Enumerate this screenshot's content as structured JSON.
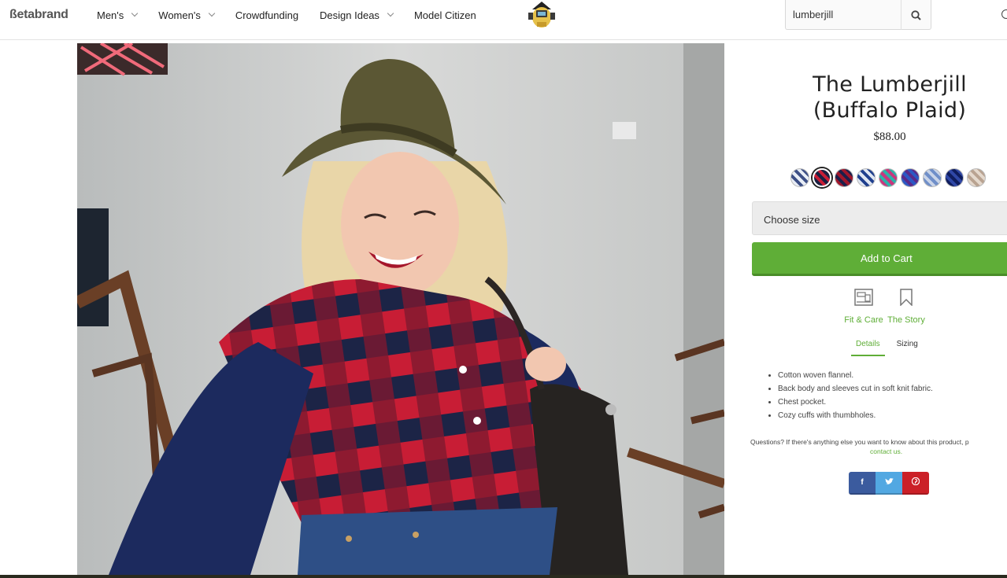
{
  "header": {
    "logo": "ßetabrand",
    "nav": [
      {
        "label": "Men's",
        "dropdown": true
      },
      {
        "label": "Women's",
        "dropdown": true
      },
      {
        "label": "Crowdfunding",
        "dropdown": false
      },
      {
        "label": "Design Ideas",
        "dropdown": true
      },
      {
        "label": "Model Citizen",
        "dropdown": false
      }
    ],
    "search": {
      "value": "lumberjill",
      "icon": "search-icon"
    }
  },
  "product": {
    "title": "The Lumberjill (Buffalo Plaid)",
    "price": "$88.00",
    "swatches": [
      {
        "color": "#3d4f86",
        "alt": "#e9eef6"
      },
      {
        "color": "#c81d35",
        "alt": "#1b2041"
      },
      {
        "color": "#1c1f4a",
        "alt": "#a0162b"
      },
      {
        "color": "#1f3f8e",
        "alt": "#dfe6f2"
      },
      {
        "color": "#2bb3a9",
        "alt": "#c8377d"
      },
      {
        "color": "#5a2a8a",
        "alt": "#2c58c4"
      },
      {
        "color": "#c9d4e8",
        "alt": "#6f8fc9"
      },
      {
        "color": "#2f47a6",
        "alt": "#0f1d5e"
      },
      {
        "color": "#b9a391",
        "alt": "#e4d8cc"
      }
    ],
    "selected_swatch": 1,
    "size_placeholder": "Choose size",
    "add_to_cart": "Add to Cart",
    "links": [
      {
        "label": "Fit & Care",
        "icon": "sewing-machine-icon"
      },
      {
        "label": "The Story",
        "icon": "bookmark-icon"
      }
    ],
    "tabs": [
      {
        "label": "Details",
        "active": true
      },
      {
        "label": "Sizing",
        "active": false
      }
    ],
    "features": [
      "Cotton woven flannel.",
      "Back body and sleeves cut in soft knit fabric.",
      "Chest pocket.",
      "Cozy cuffs with thumbholes."
    ],
    "questions_text": "Questions? If there's anything else you want to know about this product, p",
    "contact_link": "contact us.",
    "social": [
      {
        "label": "f",
        "icon": "facebook-icon",
        "color": "#3b5b9e"
      },
      {
        "label": "t",
        "icon": "twitter-icon",
        "color": "#52a8e2"
      },
      {
        "label": "p",
        "icon": "pinterest-icon",
        "color": "#cb2027"
      }
    ]
  },
  "colors": {
    "accent_green": "#5fae37",
    "plaid_red": "#c81d35",
    "plaid_navy": "#1c2446"
  }
}
